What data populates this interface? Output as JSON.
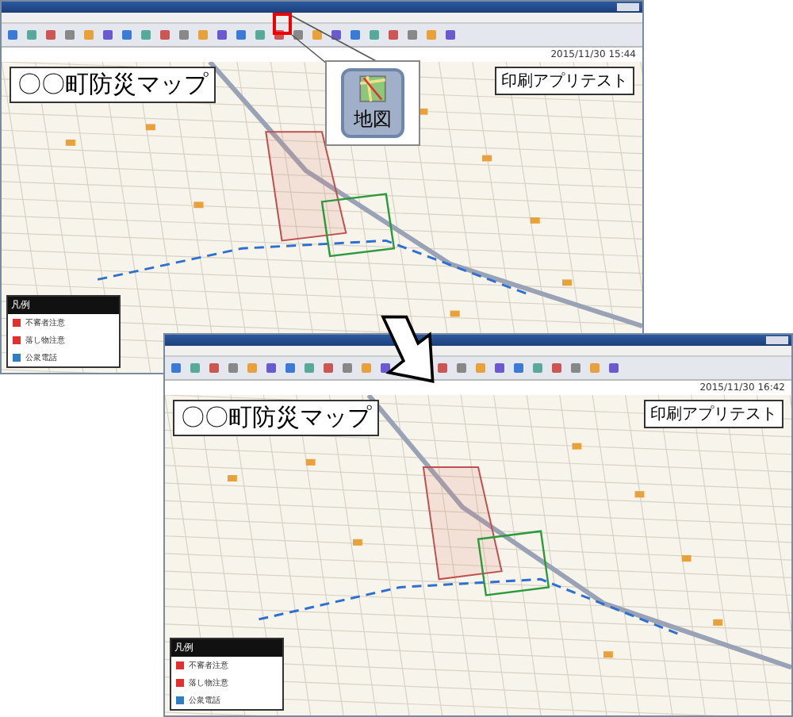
{
  "windows": [
    {
      "map_title": "〇〇町防災マップ",
      "app_label": "印刷アプリテスト",
      "timestamp": "2015/11/30 15:44",
      "legend": {
        "title": "凡例",
        "items": [
          {
            "label": "不審者注意",
            "color": "#e03030"
          },
          {
            "label": "落し物注意",
            "color": "#e03030"
          },
          {
            "label": "公衆電話",
            "color": "#2f7fc0"
          }
        ]
      }
    },
    {
      "map_title": "〇〇町防災マップ",
      "app_label": "印刷アプリテスト",
      "timestamp": "2015/11/30 16:42",
      "legend": {
        "title": "凡例",
        "items": [
          {
            "label": "不審者注意",
            "color": "#e03030"
          },
          {
            "label": "落し物注意",
            "color": "#e03030"
          },
          {
            "label": "公衆電話",
            "color": "#2f7fc0"
          }
        ]
      }
    }
  ],
  "callout": {
    "label": "地図"
  }
}
